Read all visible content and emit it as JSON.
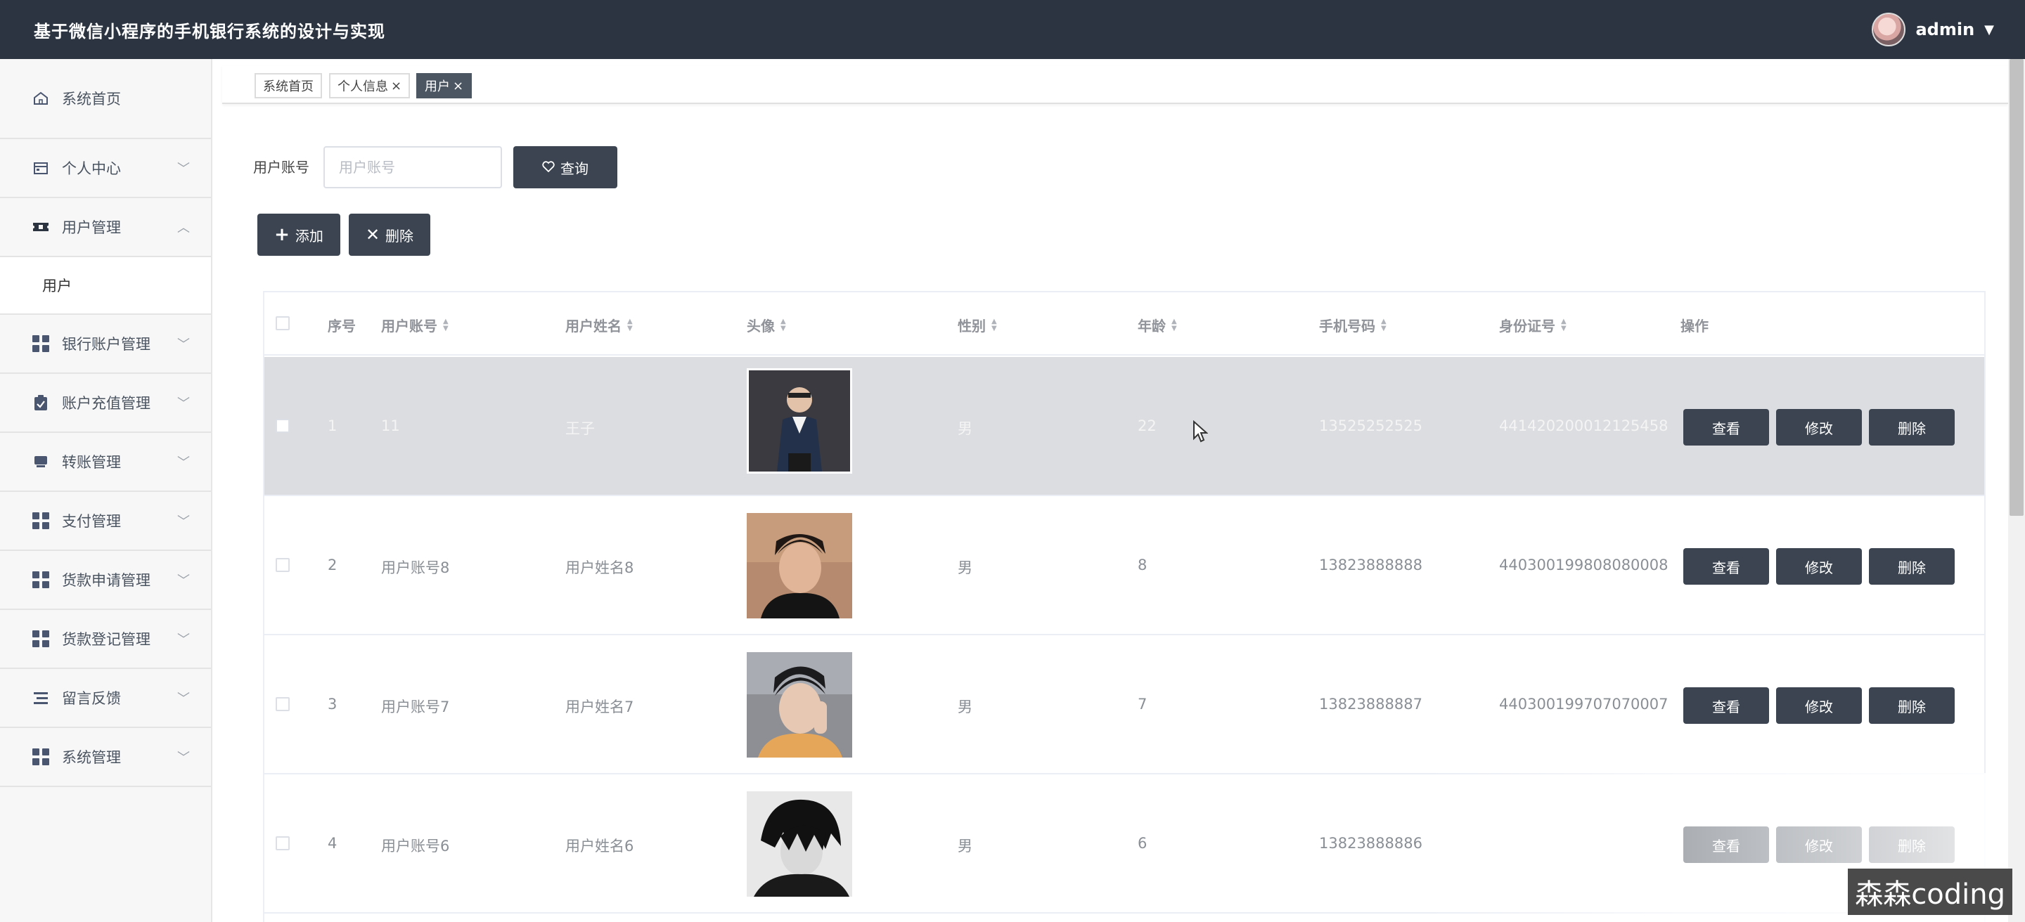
{
  "app": {
    "title": "基于微信小程序的手机银行系统的设计与实现",
    "user": "admin"
  },
  "sidebar": {
    "items": [
      {
        "label": "系统首页",
        "icon": "home-icon"
      },
      {
        "label": "个人中心",
        "icon": "calendar-icon"
      },
      {
        "label": "用户管理",
        "icon": "ticket-icon",
        "expanded": true,
        "children": [
          {
            "label": "用户"
          }
        ]
      },
      {
        "label": "银行账户管理",
        "icon": "grid-icon"
      },
      {
        "label": "账户充值管理",
        "icon": "clipboard-icon"
      },
      {
        "label": "转账管理",
        "icon": "transfer-icon"
      },
      {
        "label": "支付管理",
        "icon": "grid-icon"
      },
      {
        "label": "货款申请管理",
        "icon": "grid-icon"
      },
      {
        "label": "货款登记管理",
        "icon": "grid-icon"
      },
      {
        "label": "留言反馈",
        "icon": "list-icon"
      },
      {
        "label": "系统管理",
        "icon": "grid-icon"
      }
    ]
  },
  "tabs": [
    {
      "label": "系统首页",
      "closable": false,
      "active": false
    },
    {
      "label": "个人信息",
      "closable": true,
      "active": false
    },
    {
      "label": "用户",
      "closable": true,
      "active": true
    }
  ],
  "tab_close_glyph": "×",
  "search": {
    "label": "用户账号",
    "placeholder": "用户账号",
    "value": "",
    "query_label": "查询"
  },
  "actions": {
    "add_label": "添加",
    "delete_label": "删除"
  },
  "table": {
    "columns": [
      "序号",
      "用户账号",
      "用户姓名",
      "头像",
      "性别",
      "年龄",
      "手机号码",
      "身份证号",
      "操作"
    ],
    "sortable": [
      false,
      true,
      true,
      true,
      true,
      true,
      true,
      true,
      false
    ],
    "rows": [
      {
        "index": "1",
        "account": "11",
        "name": "王子",
        "gender": "男",
        "age": "22",
        "phone": "13525252525",
        "id_card": "441420200012125458",
        "hover": true
      },
      {
        "index": "2",
        "account": "用户账号8",
        "name": "用户姓名8",
        "gender": "男",
        "age": "8",
        "phone": "13823888888",
        "id_card": "440300199808080008",
        "hover": false
      },
      {
        "index": "3",
        "account": "用户账号7",
        "name": "用户姓名7",
        "gender": "男",
        "age": "7",
        "phone": "13823888887",
        "id_card": "440300199707070007",
        "hover": false
      },
      {
        "index": "4",
        "account": "用户账号6",
        "name": "用户姓名6",
        "gender": "男",
        "age": "6",
        "phone": "13823888886",
        "id_card": "",
        "hover": false
      }
    ],
    "row_actions": {
      "view": "查看",
      "edit": "修改",
      "delete": "删除"
    }
  },
  "watermark": "森森coding",
  "colors": {
    "topbar": "#2b3440",
    "button": "#3b4450",
    "active_tab": "#4c5663",
    "hover_row": "#dcdde0"
  }
}
